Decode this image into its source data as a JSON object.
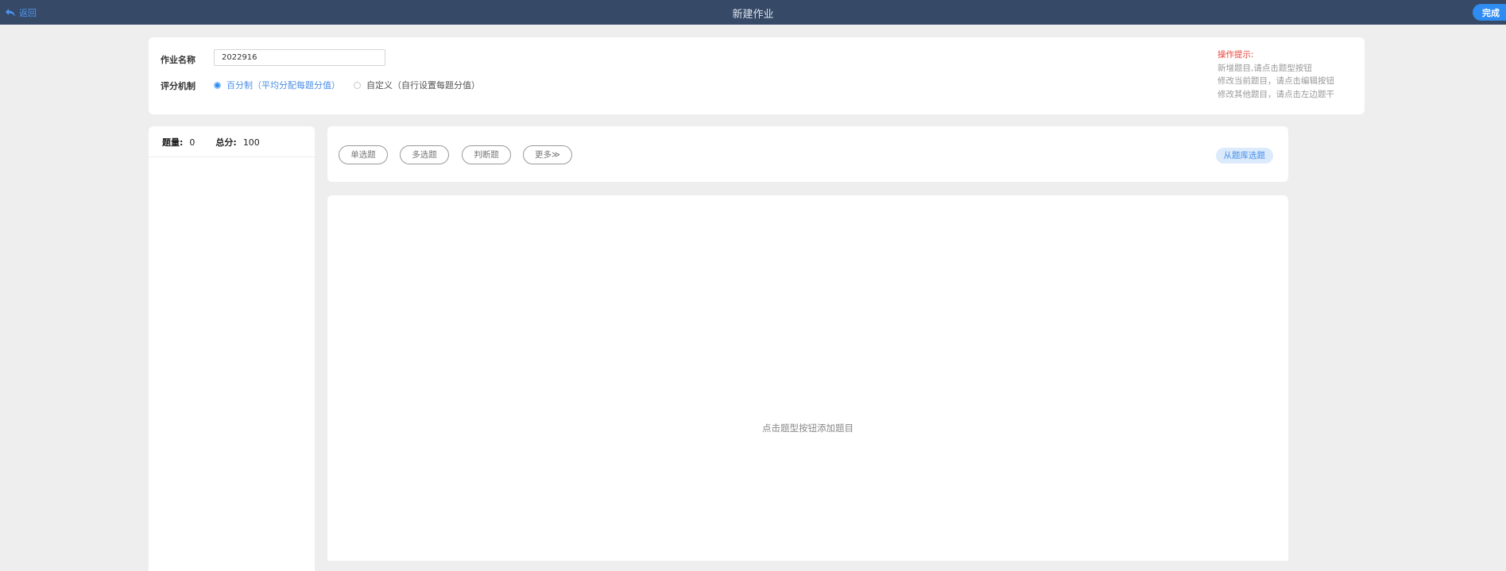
{
  "header": {
    "back_label": "返回",
    "title": "新建作业",
    "done_label": "完成"
  },
  "form": {
    "name_label": "作业名称",
    "name_value": "2022916",
    "scoring_label": "评分机制",
    "scoring_options": [
      {
        "label": "百分制（平均分配每题分值）",
        "selected": true
      },
      {
        "label": "自定义（自行设置每题分值）",
        "selected": false
      }
    ]
  },
  "tips": {
    "title": "操作提示:",
    "lines": [
      "新增题目,请点击题型按钮",
      "修改当前题目，请点击编辑按钮",
      "修改其他题目，请点击左边题干"
    ]
  },
  "summary": {
    "count_label": "题量:",
    "count_value": "0",
    "total_label": "总分:",
    "total_value": "100"
  },
  "toolbar": {
    "question_types": [
      "单选题",
      "多选题",
      "判断题",
      "更多≫"
    ],
    "bank_label": "从题库选题"
  },
  "main": {
    "empty_hint": "点击题型按钮添加题目"
  },
  "colors": {
    "header_bg": "#364a68",
    "accent": "#2f8cf2",
    "tip_title": "#e8443a"
  }
}
